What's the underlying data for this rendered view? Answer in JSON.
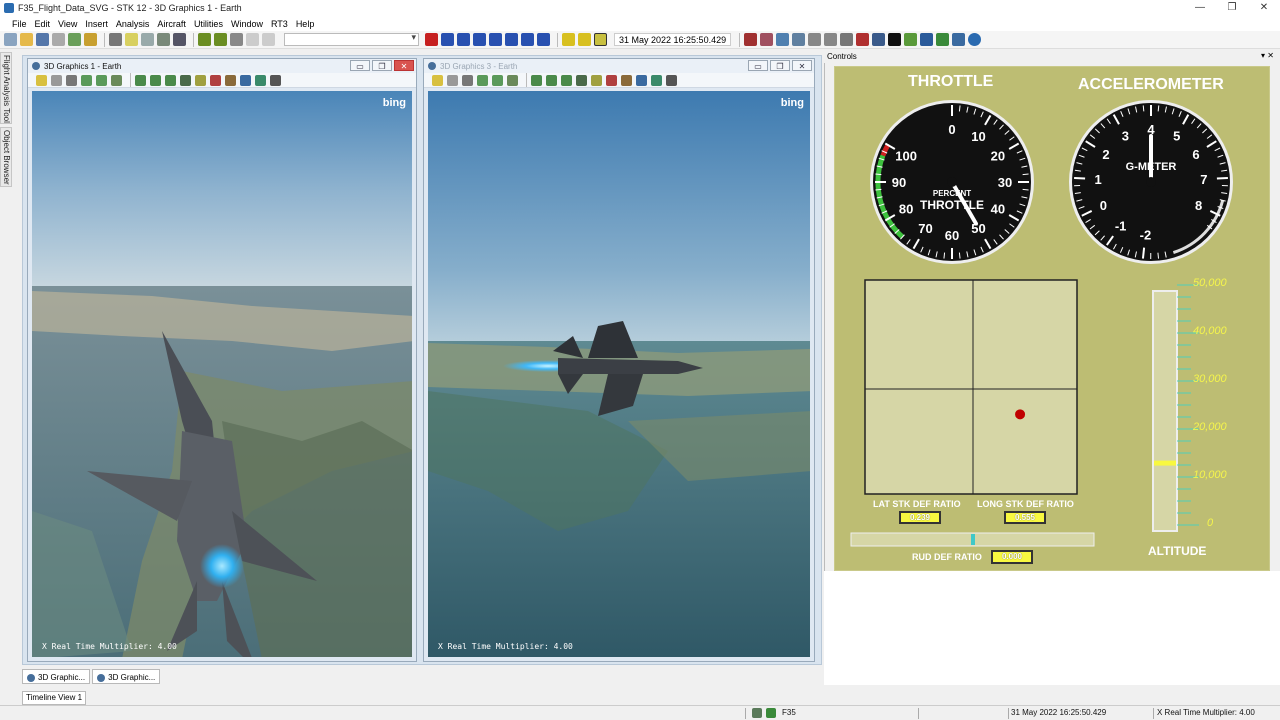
{
  "window": {
    "title": "F35_Flight_Data_SVG - STK 12 - 3D Graphics 1 - Earth",
    "controls": [
      "—",
      "❐",
      "✕"
    ]
  },
  "menu": [
    "File",
    "Edit",
    "View",
    "Insert",
    "Analysis",
    "Aircraft",
    "Utilities",
    "Window",
    "RT3",
    "Help"
  ],
  "toolbar": {
    "time": "31 May 2022 16:25:50.429"
  },
  "side_tabs": [
    "Flight Analysis Tool",
    "Object Browser"
  ],
  "graphics_windows": [
    {
      "title": "3D Graphics 1 - Earth",
      "bing": "bing",
      "overlay": "X Real Time Multiplier: 4.00",
      "controls": [
        "▭",
        "❐",
        "✕"
      ]
    },
    {
      "title": "3D Graphics 3 - Earth",
      "bing": "bing",
      "overlay": "X Real Time Multiplier: 4.00",
      "controls": [
        "▭",
        "❐",
        "✕"
      ]
    }
  ],
  "window_tabs": [
    "3D Graphic...",
    "3D Graphic..."
  ],
  "timeline_tab": "Timeline View 1",
  "statusbar": {
    "object": "F35",
    "time": "31 May 2022 16:25:50.429",
    "multiplier": "X Real Time Multiplier: 4.00"
  },
  "controls_panel": {
    "title": "Controls",
    "buttons": "▾  ✕",
    "colors": {
      "panel": "#bdbd73",
      "chart_bg": "#d6d6a6",
      "indicator": "#c00000",
      "value_box": "#f8f840",
      "rudder_indicator": "#40c8c8"
    },
    "throttle": {
      "title": "THROTTLE",
      "unit_label": "PERCENT",
      "center_label": "THROTTLE",
      "ticks": [
        "0",
        "10",
        "20",
        "30",
        "40",
        "50",
        "60",
        "70",
        "80",
        "90",
        "100"
      ],
      "value": 50
    },
    "accelerometer": {
      "title": "ACCELEROMETER",
      "center_label": "G-METER",
      "ticks": [
        "-2",
        "-1",
        "0",
        "1",
        "2",
        "3",
        "4",
        "5",
        "6",
        "7",
        "8"
      ],
      "value": 4
    },
    "stick": {
      "lat_label": "LAT STK DEF RATIO",
      "lat_value": "0.239",
      "long_label": "LONG STK DEF RATIO",
      "long_value": "0.555",
      "dot_x": 0.555,
      "dot_y": -0.239
    },
    "rudder": {
      "label": "RUD DEF RATIO",
      "value": "0.000"
    },
    "altitude": {
      "label": "ALTITUDE",
      "ticks": [
        "50,000",
        "40,000",
        "30,000",
        "20,000",
        "10,000",
        "0"
      ],
      "value": 13000
    }
  }
}
